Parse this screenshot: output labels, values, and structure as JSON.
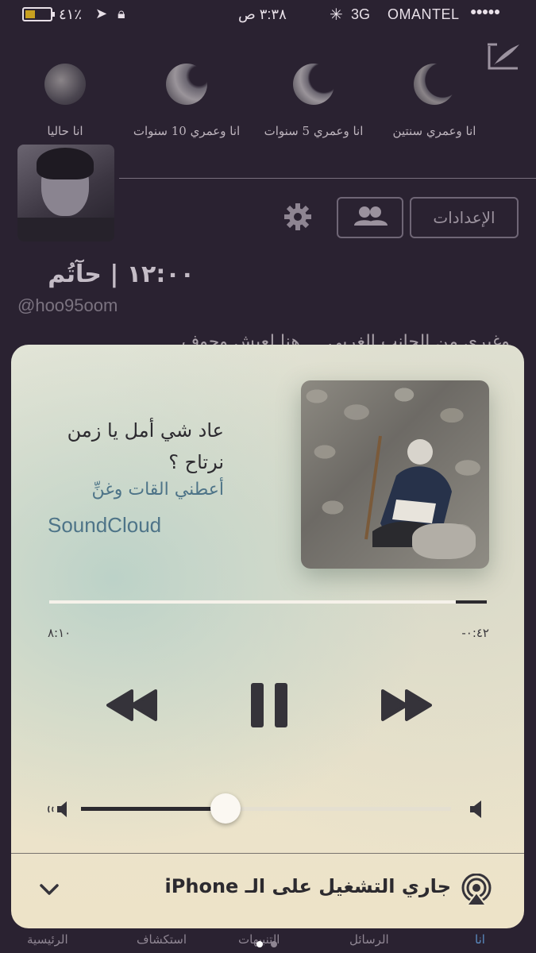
{
  "status_bar": {
    "battery_percent": "٤١٪",
    "time": "٣:٣٨ ص",
    "network": "3G",
    "carrier": "OMANTEL",
    "battery_level": 0.41
  },
  "timeline": {
    "moons": [
      {
        "label": "انا وعمري سنتين"
      },
      {
        "label": "انا وعمري 5 سنوات"
      },
      {
        "label": "انا وعمري 10 سنوات"
      },
      {
        "label": "انا حاليا"
      }
    ]
  },
  "profile": {
    "settings_label": "الإعدادات",
    "name": "١٢:٠٠ | حآتُم",
    "handle": "@hoo95oom",
    "bio": "وغيري من الجانب الغربي ... هنا لعيش وجوف"
  },
  "now_playing": {
    "title": "عاد شي أمل يا زمن نرتاح ؟",
    "artist": "أعطني القات وغنِّ",
    "source": "SoundCloud",
    "elapsed": "٨:١٠",
    "remaining": "-٠:٤٢",
    "progress": 0.93,
    "volume": 0.39,
    "airplay_label": "جاري التشغيل على الـ iPhone"
  },
  "tabbar": {
    "tabs": [
      {
        "label": "انا",
        "active": true
      },
      {
        "label": "الرسائل",
        "active": false
      },
      {
        "label": "التنبيهات",
        "active": false
      },
      {
        "label": "استكشاف",
        "active": false
      },
      {
        "label": "الرئيسية",
        "active": false
      }
    ]
  },
  "colors": {
    "background": "#2a2231",
    "accent": "#4e7488",
    "active_tab": "#5a8ac0"
  }
}
